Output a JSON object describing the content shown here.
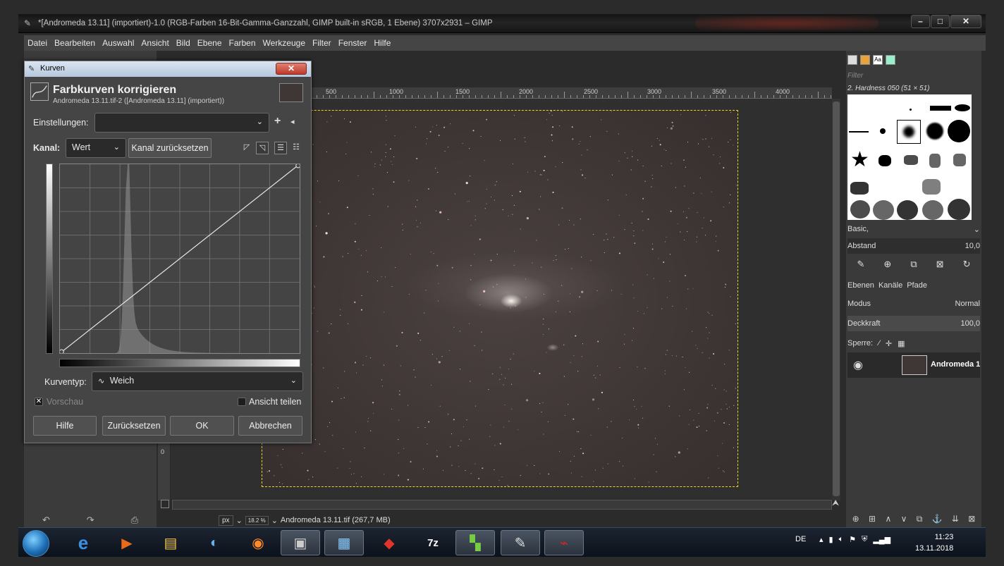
{
  "window": {
    "title": "*[Andromeda 13.11] (importiert)-1.0 (RGB-Farben 16-Bit-Gamma-Ganzzahl, GIMP built-in sRGB, 1 Ebene) 3707x2931 – GIMP"
  },
  "menubar": [
    "Datei",
    "Bearbeiten",
    "Auswahl",
    "Ansicht",
    "Bild",
    "Ebene",
    "Farben",
    "Werkzeuge",
    "Filter",
    "Fenster",
    "Hilfe"
  ],
  "ruler": [
    "500",
    "1000",
    "1500",
    "2000",
    "2500",
    "3000",
    "3500",
    "4000"
  ],
  "ruler_vertical_label": "0",
  "status": {
    "unit": "px",
    "zoom": "18.2 %",
    "file": "Andromeda 13.11.tif (267,7 MB)"
  },
  "dialog": {
    "window_title": "Kurven",
    "heading": "Farbkurven korrigieren",
    "subheading": "Andromeda 13.11.tif-2 ([Andromeda 13.11] (importiert))",
    "settings_label": "Einstellungen:",
    "settings_value": "",
    "channel_label": "Kanal:",
    "channel_value": "Wert",
    "reset_channel": "Kanal zurücksetzen",
    "curve_type_label": "Kurventyp:",
    "curve_type_value": "Weich",
    "preview_label": "Vorschau",
    "split_view_label": "Ansicht teilen",
    "buttons": {
      "help": "Hilfe",
      "reset": "Zurücksetzen",
      "ok": "OK",
      "cancel": "Abbrechen"
    }
  },
  "right_dock": {
    "filter_placeholder": "Filter",
    "brush_name": "2. Hardness 050 (51 × 51)",
    "brush_set": "Basic,",
    "spacing_label": "Abstand",
    "spacing_value": "10,0",
    "tabs": {
      "layers": "Ebenen",
      "channels": "Kanäle",
      "paths": "Pfade"
    },
    "mode_label": "Modus",
    "mode_value": "Normal",
    "opacity_label": "Deckkraft",
    "opacity_value": "100,0",
    "lock_label": "Sperre:",
    "layer_name": "Andromeda 1"
  },
  "taskbar": {
    "language": "DE",
    "time": "11:23",
    "date": "13.11.2018",
    "apps": [
      "ie-icon",
      "media-player-icon",
      "explorer-icon",
      "app-icon",
      "firefox-icon",
      "photo-icon",
      "network-icon",
      "app-red-icon",
      "7zip-icon",
      "app-green-icon",
      "gimp-icon",
      "pdf-icon"
    ]
  }
}
